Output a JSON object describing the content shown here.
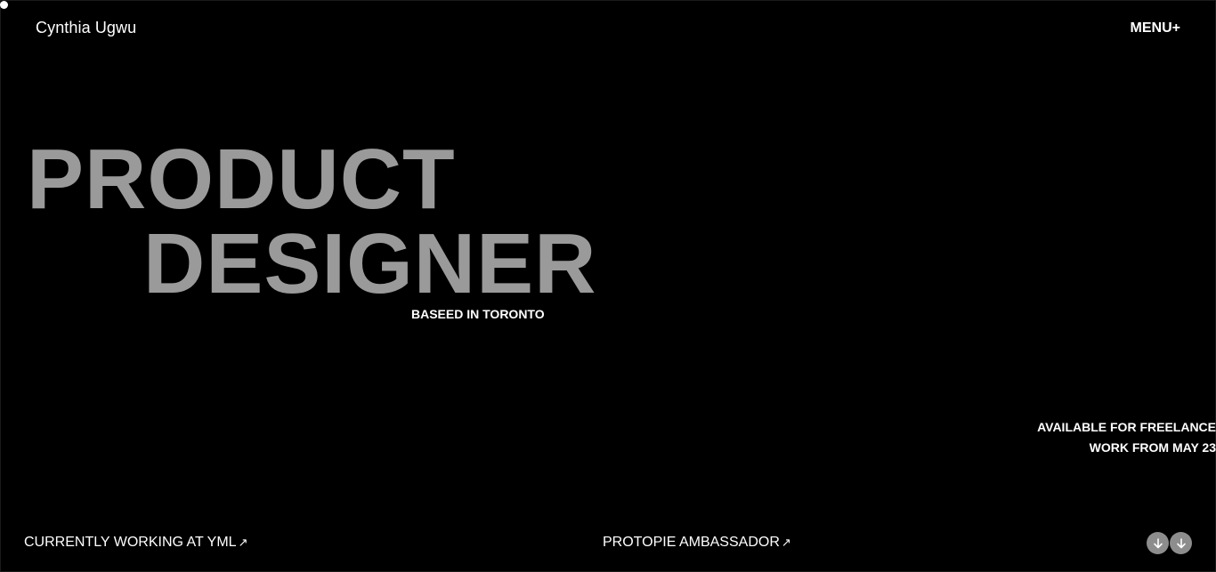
{
  "header": {
    "logo_text": "Cynthia Ugwu",
    "menu_label": "MENU+"
  },
  "hero": {
    "line1": "PRODUCT",
    "line2": "DESIGNER",
    "location": "BASEED IN TORONTO"
  },
  "availability": {
    "line1": "AVAILABLE FOR FREELANCE",
    "line2": "WORK FROM MAY 23"
  },
  "footer": {
    "work_link": "CURRENTLY WORKING AT YML",
    "protopie_link": "PROTOPIE AMBASSADOR",
    "external_icon": "arrow-up-right-icon",
    "scroll_icon": "arrow-down-icon"
  },
  "colors": {
    "background": "#000000",
    "hero_text": "#9a9a9a",
    "text": "#ffffff",
    "circle_button": "#8d8d8d"
  }
}
